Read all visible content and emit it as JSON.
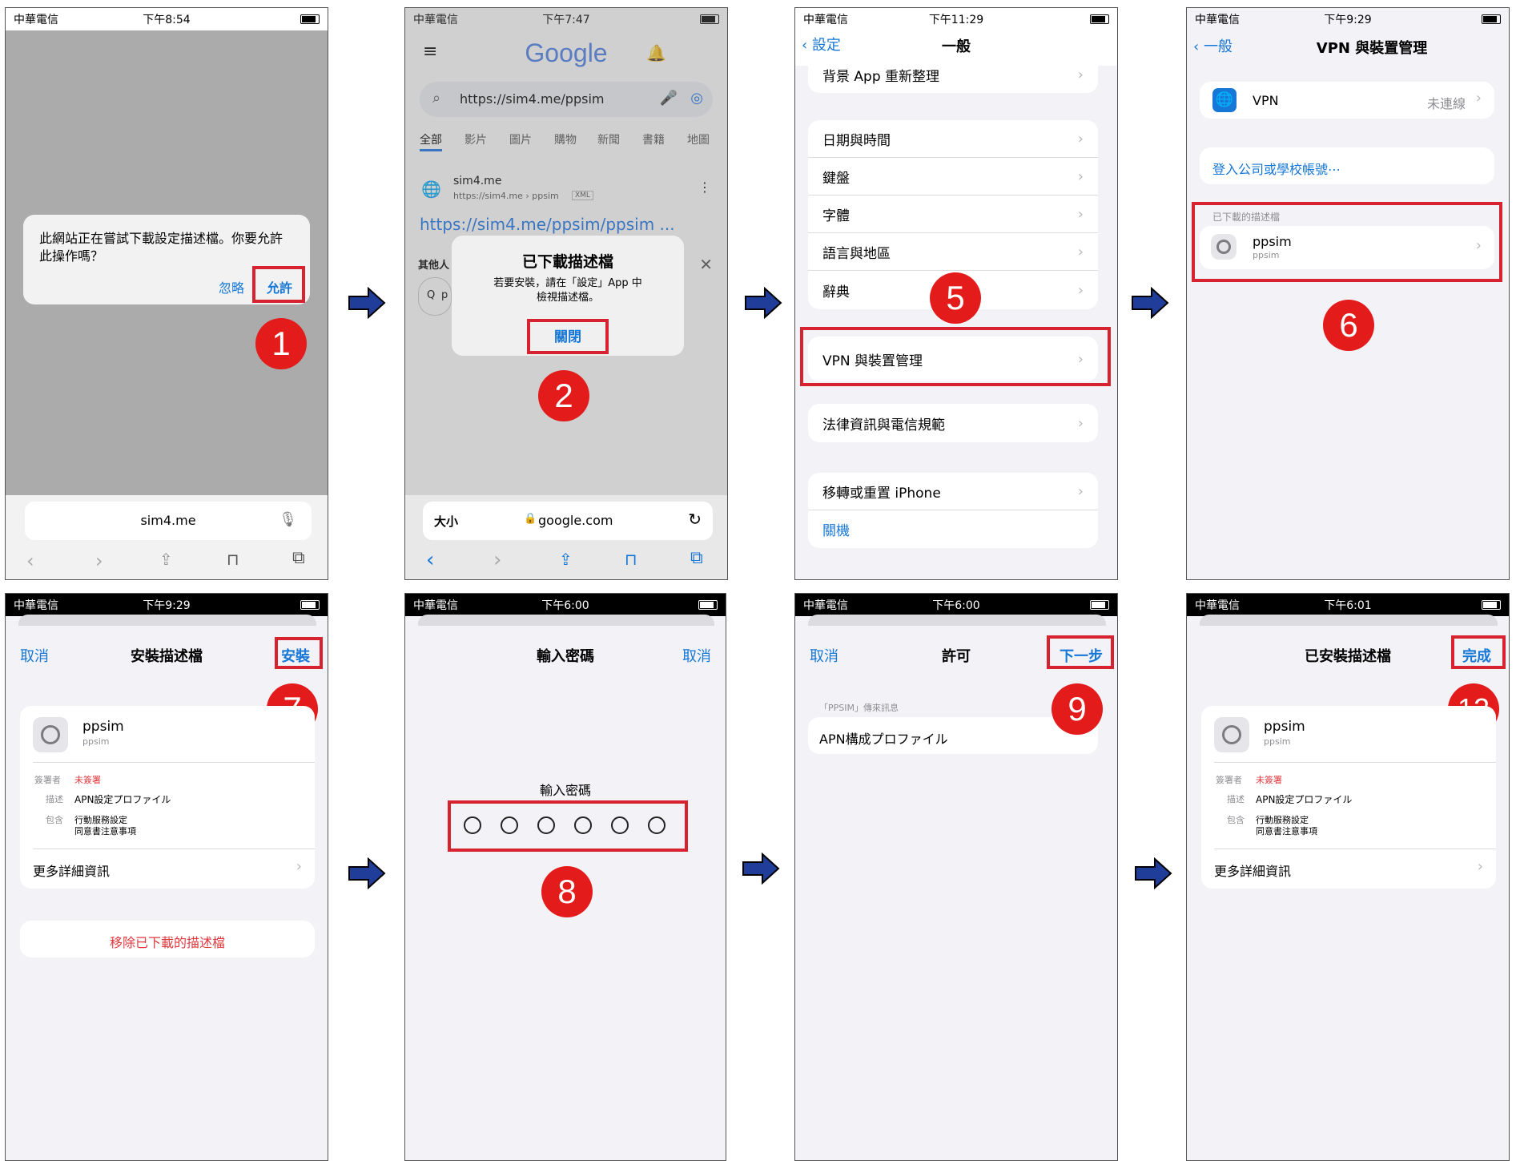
{
  "colors": {
    "badge_red": "#e31b1b",
    "highlight_red": "#d7222f",
    "arrow_blue": "#1f3d99",
    "ios_blue": "#1677d6"
  },
  "arrows": [
    "right-arrow-icon",
    "right-arrow-icon",
    "right-arrow-icon",
    "right-arrow-icon",
    "right-arrow-icon",
    "right-arrow-icon"
  ],
  "s1": {
    "status": {
      "carrier": "中華電信",
      "time": "下午8:54"
    },
    "alert": {
      "message_line1": "此網站正在嘗試下載設定描述檔。你要允許",
      "message_line2": "此操作嗎？",
      "ignore": "忽略",
      "allow": "允許"
    },
    "address": "sim4.me",
    "badge": "1"
  },
  "s2": {
    "status": {
      "carrier": "中華電信",
      "time": "下午7:47"
    },
    "logo": "Google",
    "search_value": "https://sim4.me/ppsim",
    "tabs": [
      "全部",
      "影片",
      "圖片",
      "購物",
      "新聞",
      "書籍",
      "地圖"
    ],
    "result": {
      "site": "sim4.me",
      "path": "https://sim4.me › ppsim",
      "type": "XML",
      "link": "https://sim4.me/ppsim/ppsim ..."
    },
    "others": "其他人",
    "others_search_prefix": "Q",
    "others_search_text": "p",
    "dialog": {
      "title": "已下載描述檔",
      "line1": "若要安裝，請在「設定」App 中",
      "line2": "檢視描述檔。",
      "close": "關閉"
    },
    "bottom": {
      "text_size": "大小",
      "url": "google.com"
    },
    "badge": "2"
  },
  "s3": {
    "status": {
      "carrier": "中華電信",
      "time": "下午11:29"
    },
    "back": "設定",
    "title": "一般",
    "top_item": "背景 App 重新整理",
    "group1": [
      "日期與時間",
      "鍵盤",
      "字體",
      "語言與地區",
      "辭典"
    ],
    "vpn": "VPN 與裝置管理",
    "legal": "法律資訊與電信規範",
    "transfer": "移轉或重置 iPhone",
    "shutdown": "關機",
    "badge": "5"
  },
  "s4": {
    "status": {
      "carrier": "中華電信",
      "time": "下午9:29"
    },
    "back": "一般",
    "title": "VPN 與裝置管理",
    "vpn_label": "VPN",
    "vpn_status": "未連線",
    "signin": "登入公司或學校帳號⋯",
    "section": "已下載的描述檔",
    "profile_name": "ppsim",
    "profile_sub": "ppsim",
    "badge": "6"
  },
  "s5": {
    "status": {
      "carrier": "中華電信",
      "time": "下午9:29"
    },
    "cancel": "取消",
    "title": "安裝描述檔",
    "install": "安裝",
    "profile_name": "ppsim",
    "profile_sub": "ppsim",
    "signed_label": "簽署者",
    "signed_value": "未簽署",
    "desc_label": "描述",
    "desc_value": "APN設定プロファイル",
    "contains_label": "包含",
    "contains_1": "行動服務設定",
    "contains_2": "同意書注意事項",
    "more": "更多詳細資訊",
    "remove": "移除已下載的描述檔",
    "badge": "7"
  },
  "s6": {
    "status": {
      "carrier": "中華電信",
      "time": "下午6:00"
    },
    "title": "輸入密碼",
    "cancel": "取消",
    "prompt": "輸入密碼",
    "badge": "8"
  },
  "s7": {
    "status": {
      "carrier": "中華電信",
      "time": "下午6:00"
    },
    "cancel": "取消",
    "title": "許可",
    "next": "下一步",
    "section": "「PPSIM」傳來訊息",
    "message": "APN構成プロファイル",
    "badge": "9"
  },
  "s8": {
    "status": {
      "carrier": "中華電信",
      "time": "下午6:01"
    },
    "title": "已安裝描述檔",
    "done": "完成",
    "profile_name": "ppsim",
    "profile_sub": "ppsim",
    "signed_label": "簽署者",
    "signed_value": "未簽署",
    "desc_label": "描述",
    "desc_value": "APN設定プロファイル",
    "contains_label": "包含",
    "contains_1": "行動服務設定",
    "contains_2": "同意書注意事項",
    "more": "更多詳細資訊",
    "badge": "12"
  }
}
